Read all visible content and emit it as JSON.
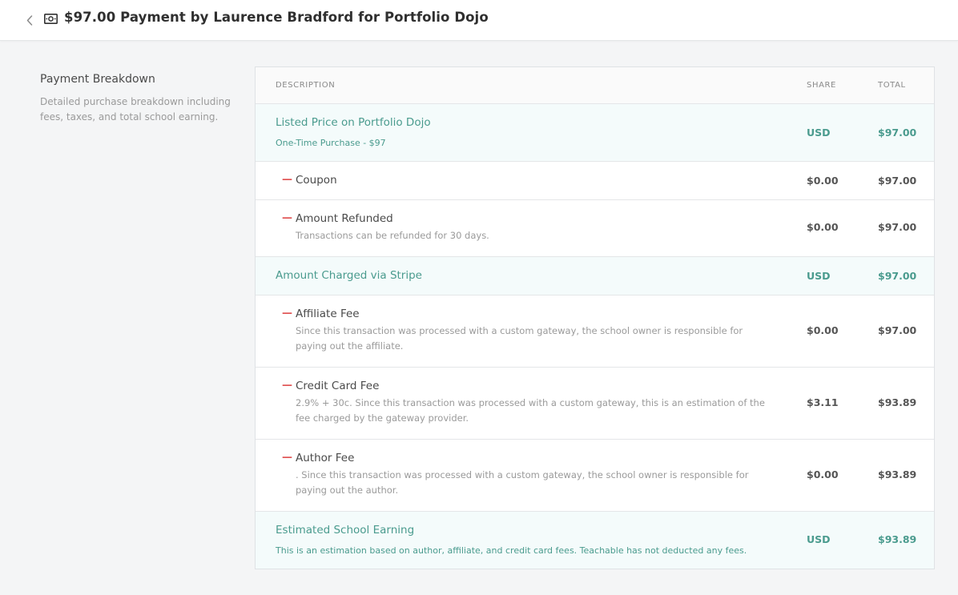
{
  "header": {
    "title": "$97.00 Payment by Laurence Bradford for Portfolio Dojo",
    "back_icon": "chevron-left-icon",
    "money_icon": "banknote-icon"
  },
  "sidebar": {
    "title": "Payment Breakdown",
    "description": "Detailed purchase breakdown including fees, taxes, and total school earning."
  },
  "table": {
    "columns": {
      "description": "DESCRIPTION",
      "share": "SHARE",
      "total": "TOTAL"
    },
    "rows": [
      {
        "label": "Listed Price on Portfolio Dojo",
        "sub": "One-Time Purchase - $97",
        "share": "USD",
        "total": "$97.00",
        "highlight": true
      },
      {
        "label": "Coupon",
        "sub": "",
        "share": "$0.00",
        "total": "$97.00",
        "dash": "—"
      },
      {
        "label": "Amount Refunded",
        "sub": "Transactions can be refunded for 30 days.",
        "share": "$0.00",
        "total": "$97.00",
        "dash": "—"
      },
      {
        "label": "Amount Charged via Stripe",
        "sub": "",
        "share": "USD",
        "total": "$97.00",
        "highlight": true
      },
      {
        "label": "Affiliate Fee",
        "sub": "Since this transaction was processed with a custom gateway, the school owner is responsible for paying out the affiliate.",
        "share": "$0.00",
        "total": "$97.00",
        "dash": "—"
      },
      {
        "label": "Credit Card Fee",
        "sub": "2.9% + 30c. Since this transaction was processed with a custom gateway, this is an estimation of the fee charged by the gateway provider.",
        "share": "$3.11",
        "total": "$93.89",
        "dash": "—"
      },
      {
        "label": "Author Fee",
        "sub": ". Since this transaction was processed with a custom gateway, the school owner is responsible for paying out the author.",
        "share": "$0.00",
        "total": "$93.89",
        "dash": "—"
      },
      {
        "label": "Estimated School Earning",
        "sub": "This is an estimation based on author, affiliate, and credit card fees. Teachable has not deducted any fees.",
        "share": "USD",
        "total": "$93.89",
        "highlight": true
      }
    ]
  },
  "colors": {
    "accent": "#4a9b8e",
    "minus": "#e05252",
    "highlight_bg": "#f4fbfb"
  }
}
